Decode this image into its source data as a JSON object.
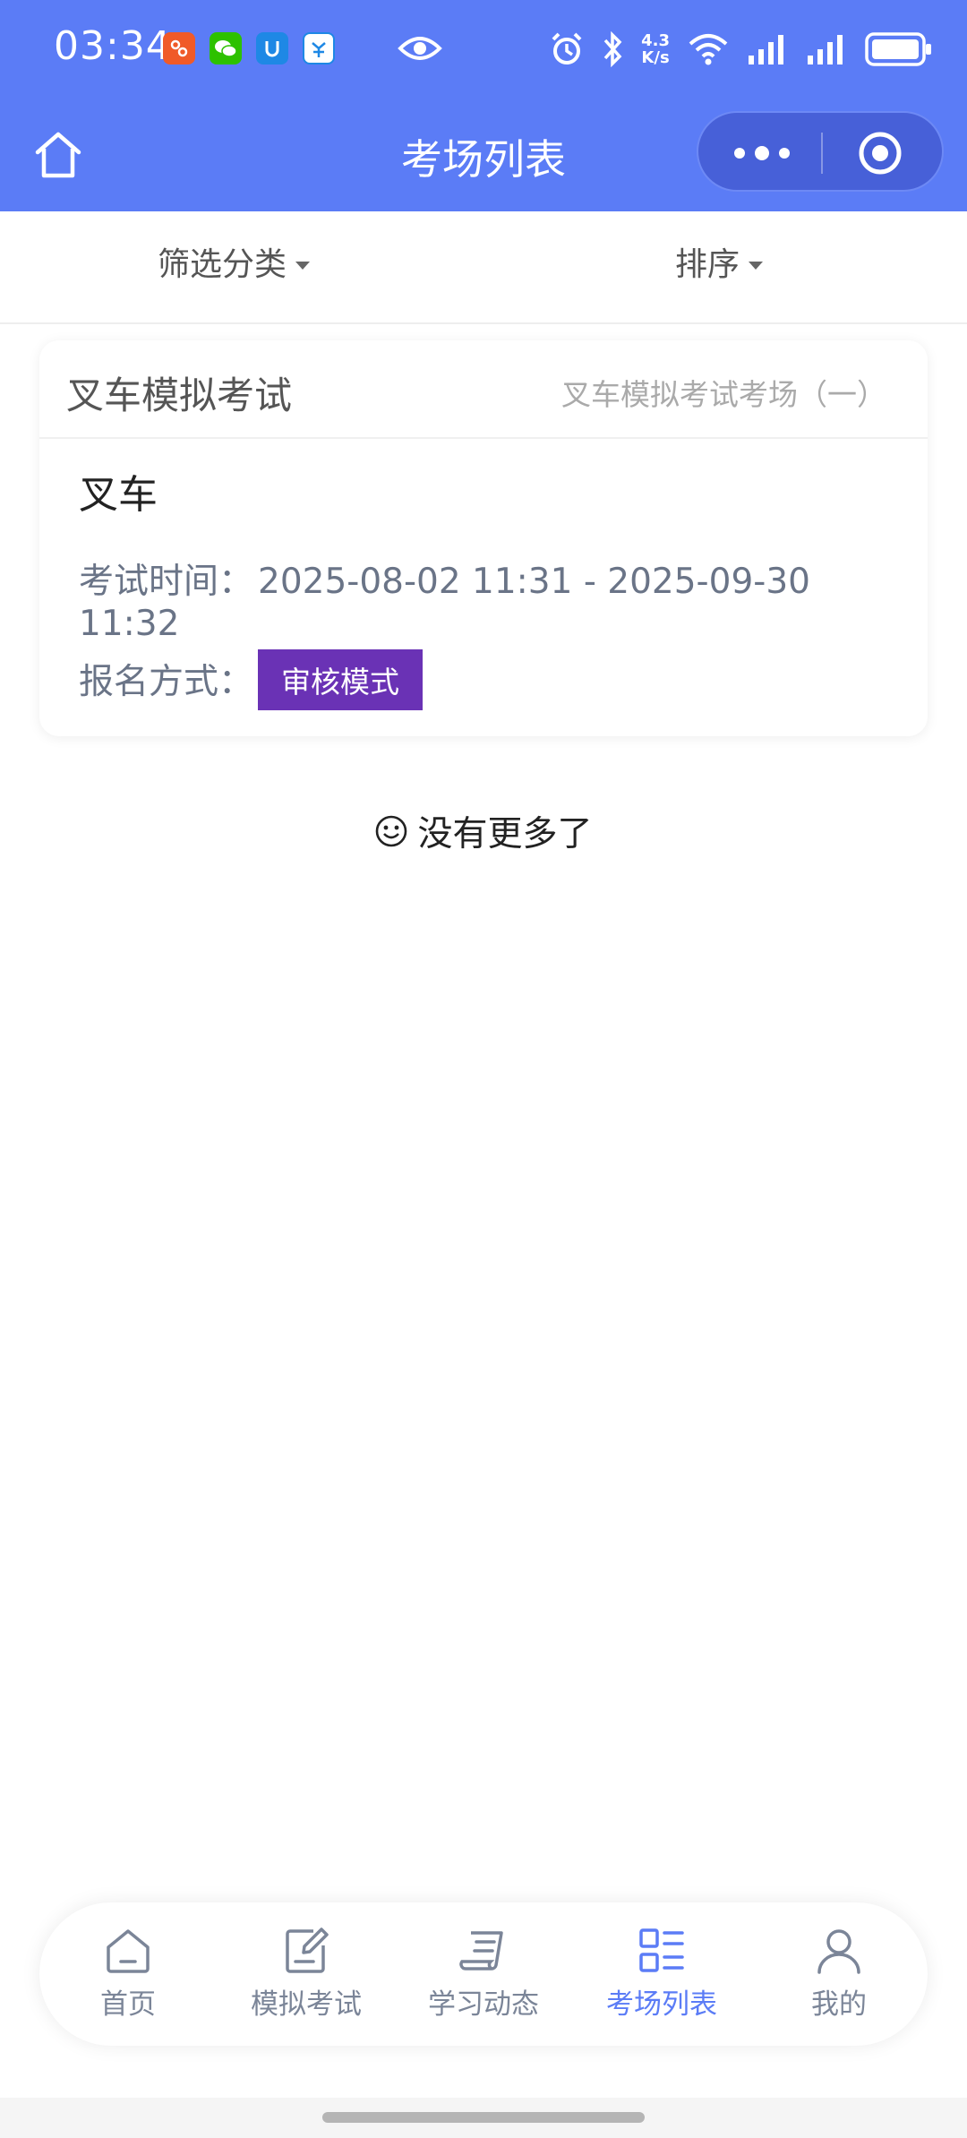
{
  "status_bar": {
    "time": "03:34",
    "net_speed_value": "4.3",
    "net_speed_unit": "K/s"
  },
  "title_bar": {
    "title": "考场列表"
  },
  "filters": {
    "category_label": "筛选分类",
    "sort_label": "排序"
  },
  "card": {
    "title": "叉车模拟考试",
    "subtitle": "叉车模拟考试考场（一）",
    "exam_name": "叉车",
    "time_label": "考试时间：",
    "time_value": "2025-08-02 11:31 - 2025-09-30 11:32",
    "registration_label": "报名方式：",
    "registration_badge": "审核模式"
  },
  "no_more_text": "没有更多了",
  "tabs": [
    {
      "label": "首页",
      "icon": "home-icon",
      "active": false
    },
    {
      "label": "模拟考试",
      "icon": "edit-note-icon",
      "active": false
    },
    {
      "label": "学习动态",
      "icon": "scroll-doc-icon",
      "active": false
    },
    {
      "label": "考场列表",
      "icon": "list-icon",
      "active": true
    },
    {
      "label": "我的",
      "icon": "user-icon",
      "active": false
    }
  ],
  "colors": {
    "primary": "#5b7cf6",
    "badge": "#6a32b5",
    "muted_text": "#6a7487"
  }
}
